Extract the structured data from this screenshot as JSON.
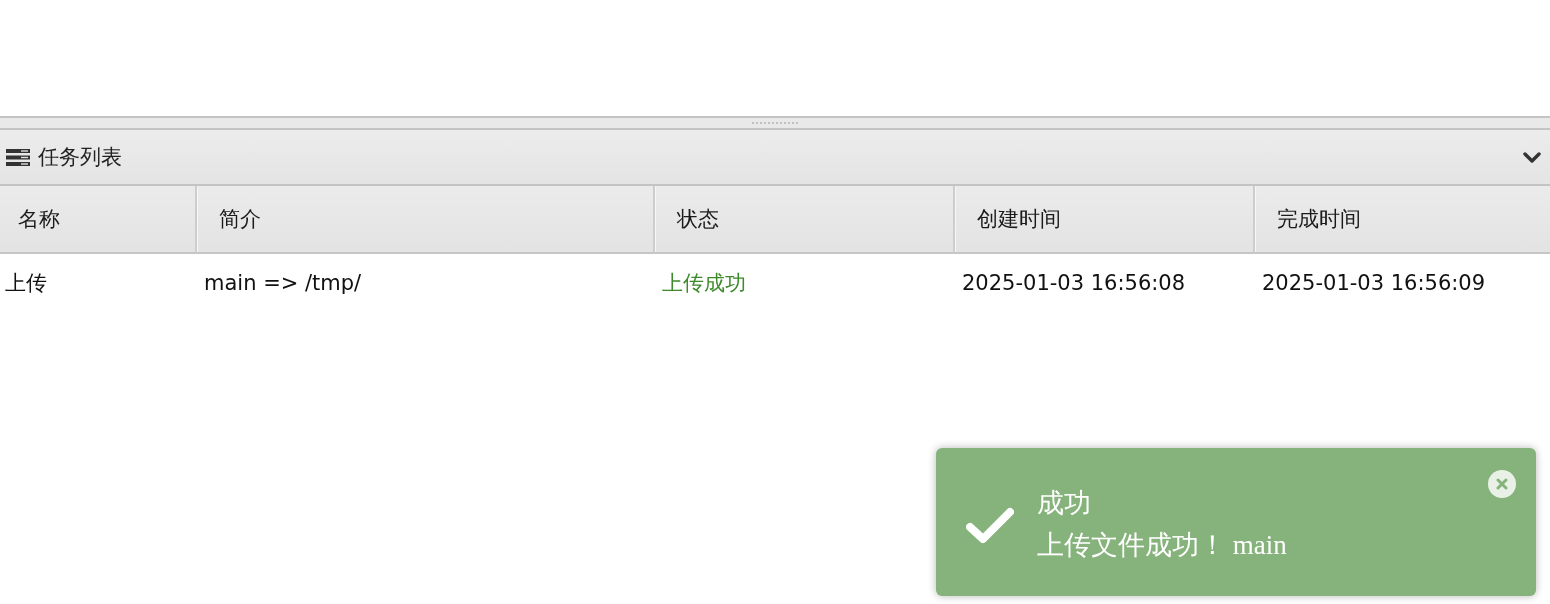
{
  "panel": {
    "title": "任务列表"
  },
  "table": {
    "columns": [
      "名称",
      "简介",
      "状态",
      "创建时间",
      "完成时间"
    ],
    "rows": [
      {
        "name": "上传",
        "description": "main => /tmp/",
        "status": {
          "label": "上传成功",
          "kind": "success"
        },
        "created": "2025-01-03 16:56:08",
        "finished": "2025-01-03 16:56:09"
      }
    ]
  },
  "toast": {
    "kind": "success",
    "title": "成功",
    "message": "上传文件成功！ main"
  }
}
